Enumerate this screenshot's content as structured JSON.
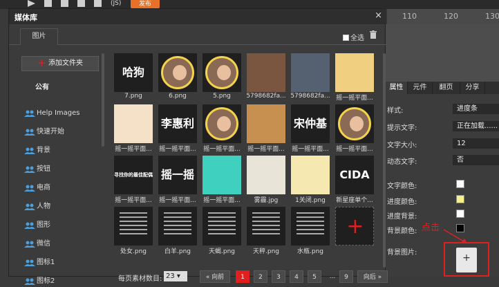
{
  "toolbar": {
    "publish_label": "发布",
    "code_label": "(JS)"
  },
  "ruler": {
    "ticks": [
      "110",
      "120",
      "130"
    ]
  },
  "dialog": {
    "title": "媒体库",
    "close_glyph": "×",
    "tab_images": "图片",
    "select_all": "全选",
    "add_folder": "添加文件夹",
    "public_label": "公有"
  },
  "sidebar": {
    "items": [
      {
        "label": "Help Images"
      },
      {
        "label": "快速开始"
      },
      {
        "label": "背景"
      },
      {
        "label": "按钮"
      },
      {
        "label": "电商"
      },
      {
        "label": "人物"
      },
      {
        "label": "图形"
      },
      {
        "label": "微信"
      },
      {
        "label": "图标1"
      },
      {
        "label": "图标2"
      }
    ]
  },
  "grid": {
    "items": [
      {
        "caption": "7.png",
        "kind": "text",
        "text": "哈狗"
      },
      {
        "caption": "6.png",
        "kind": "portrait"
      },
      {
        "caption": "5.png",
        "kind": "portrait"
      },
      {
        "caption": "5798682fa...",
        "kind": "photo",
        "color": "#7a5540"
      },
      {
        "caption": "5798682fa...",
        "kind": "photo",
        "color": "#556070"
      },
      {
        "caption": "摇一摇平面...",
        "kind": "photo",
        "color": "#f0d080"
      },
      {
        "caption": "摇一摇平面...",
        "kind": "photo",
        "color": "#f5e0c8"
      },
      {
        "caption": "摇一摇平面...",
        "kind": "text",
        "text": "李惠利"
      },
      {
        "caption": "摇一摇平面...",
        "kind": "portrait"
      },
      {
        "caption": "摇一摇平面...",
        "kind": "photo",
        "color": "#c89050"
      },
      {
        "caption": "摇一摇平面...",
        "kind": "text",
        "text": "宋仲基"
      },
      {
        "caption": "摇一摇平面...",
        "kind": "portrait"
      },
      {
        "caption": "摇一摇平面...",
        "kind": "text",
        "text": "寻找你的最佳配偶"
      },
      {
        "caption": "摇一摇平面...",
        "kind": "text",
        "text": "摇一摇"
      },
      {
        "caption": "摇一摇平面...",
        "kind": "photo",
        "color": "#3fd0c0"
      },
      {
        "caption": "雾霾.jpg",
        "kind": "photo",
        "color": "#e8e4d8"
      },
      {
        "caption": "1关闭.png",
        "kind": "photo",
        "color": "#f5e8b0"
      },
      {
        "caption": "新星座单个...",
        "kind": "text",
        "text": "CIDA"
      },
      {
        "caption": "处女.png",
        "kind": "doc"
      },
      {
        "caption": "白羊.png",
        "kind": "doc"
      },
      {
        "caption": "天蝎.png",
        "kind": "doc"
      },
      {
        "caption": "天秤.png",
        "kind": "doc"
      },
      {
        "caption": "水瓶.png",
        "kind": "doc"
      },
      {
        "caption": "",
        "kind": "add"
      }
    ]
  },
  "pager": {
    "per_page_label": "每页素材数目:",
    "per_page_value": "23",
    "prev": "« 向前",
    "next": "向后 »",
    "pages": [
      "1",
      "2",
      "3",
      "4",
      "5",
      "...",
      "9"
    ],
    "active": "1"
  },
  "props": {
    "tabs": [
      "属性",
      "元件",
      "翻页",
      "分享"
    ],
    "rows": [
      {
        "label": "样式:",
        "value": "进度条"
      },
      {
        "label": "提示文字:",
        "value": "正在加载......"
      },
      {
        "label": "文字大小:",
        "value": "12"
      },
      {
        "label": "动态文字:",
        "value": "否"
      }
    ],
    "colors": [
      {
        "label": "文字颜色:",
        "color": "#ffffff"
      },
      {
        "label": "进度颜色:",
        "color": "#f7f08a"
      },
      {
        "label": "进度背景:",
        "color": "#ffffff"
      },
      {
        "label": "背景颜色:",
        "color": "#000000"
      }
    ],
    "bg_image_label": "背景图片:",
    "hint": "点击"
  }
}
